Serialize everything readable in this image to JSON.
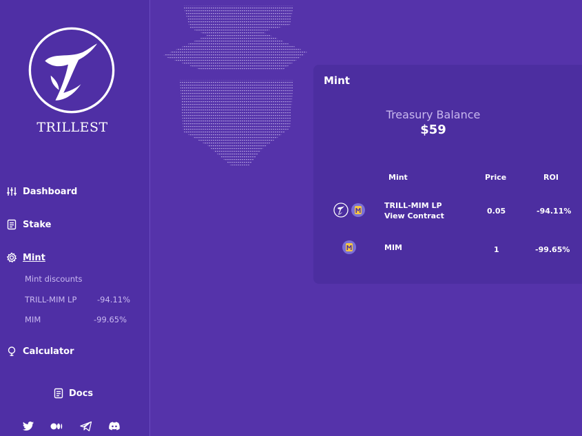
{
  "brand": {
    "name": "TRILLEST"
  },
  "nav": {
    "dashboard": "Dashboard",
    "stake": "Stake",
    "mint": "Mint",
    "calculator": "Calculator",
    "docs": "Docs"
  },
  "mint_discounts": {
    "heading": "Mint discounts",
    "items": [
      {
        "name": "TRILL-MIM LP",
        "value": "-94.11%"
      },
      {
        "name": "MIM",
        "value": "-99.65%"
      }
    ]
  },
  "social": [
    "twitter-icon",
    "medium-icon",
    "telegram-icon",
    "discord-icon"
  ],
  "card": {
    "title": "Mint",
    "treasury_label": "Treasury Balance",
    "treasury_value": "$59",
    "columns": {
      "mint": "Mint",
      "price": "Price",
      "roi": "ROI"
    },
    "rows": [
      {
        "name": "TRILL-MIM LP",
        "link": "View Contract",
        "price": "0.05",
        "roi": "-94.11%"
      },
      {
        "name": "MIM",
        "link": "",
        "price": "1",
        "roi": "-99.65%"
      }
    ]
  },
  "colors": {
    "background": "#5533aa",
    "sidebar": "#4f2fa5",
    "card": "#4c2ea0",
    "mim_yellow": "#f5c542"
  }
}
